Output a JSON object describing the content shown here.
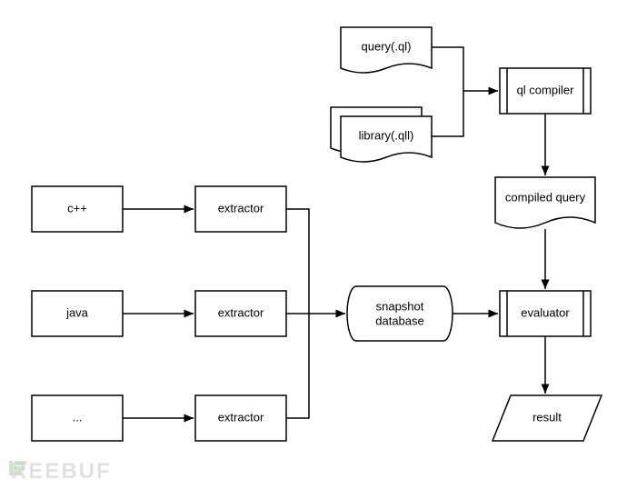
{
  "nodes": {
    "cpp": "c++",
    "java": "java",
    "other": "...",
    "extractor1": "extractor",
    "extractor2": "extractor",
    "extractor3": "extractor",
    "queryql": "query(.ql)",
    "libraryqll": "library(.qll)",
    "qlcompiler": "ql compiler",
    "compiledquery": "compiled query",
    "snapshotdb": "snapshot\ndatabase",
    "evaluator": "evaluator",
    "result": "result"
  },
  "watermark": "REEBUF"
}
